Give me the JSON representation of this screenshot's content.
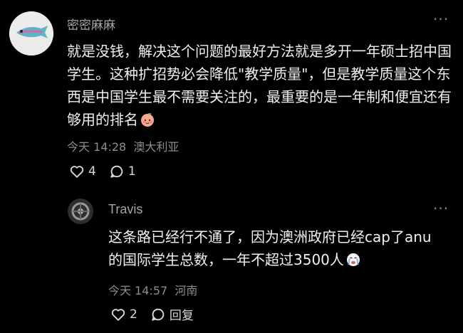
{
  "comments": [
    {
      "username": "密密麻麻",
      "text": "就是没钱，解决这个问题的最好方法就是多开一年硕士招中国学生。这种扩招势必会降低\"教学质量\"，但是教学质量这个东西是中国学生最不需要关注的，最重要的是一年制和便宜还有够用的排名",
      "emoji_icon": "peach-face-icon",
      "time": "今天 14:28",
      "location": "澳大利亚",
      "like_count": "4",
      "reply_count": "1"
    },
    {
      "username": "Travis",
      "text": "这条路已经行不通了，因为澳洲政府已经cap了anu的国际学生总数，一年不超过3500人",
      "emoji_icon": "crying-face-icon",
      "time": "今天 14:57",
      "location": "河南",
      "like_count": "2",
      "reply_label": "回复"
    }
  ],
  "more_glyph": "···"
}
